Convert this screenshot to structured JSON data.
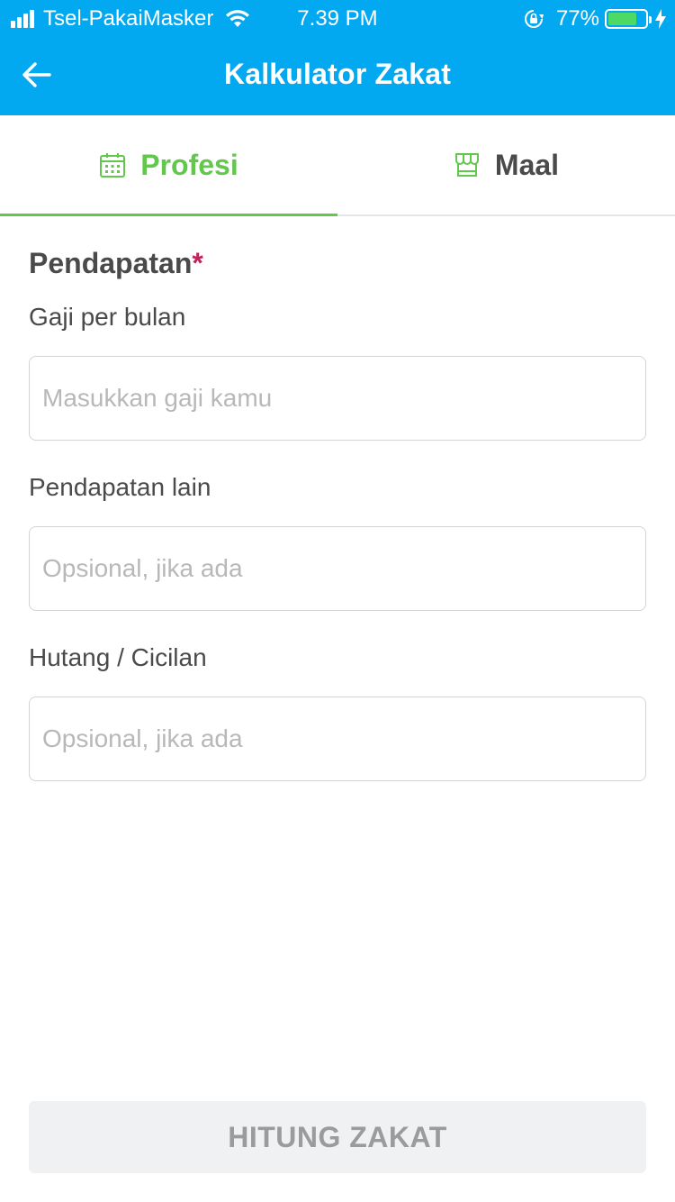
{
  "status_bar": {
    "carrier": "Tsel-PakaiMasker",
    "time": "7.39 PM",
    "battery_percent": "77%",
    "battery_level": 0.77,
    "icons": [
      "signal-icon",
      "wifi-icon",
      "rotation-lock-icon",
      "battery-icon",
      "charging-bolt-icon"
    ]
  },
  "header": {
    "title": "Kalkulator Zakat",
    "back_icon": "arrow-left-icon",
    "background": "#03a9f0"
  },
  "tabs": [
    {
      "label": "Profesi",
      "icon": "calendar-icon",
      "active": true
    },
    {
      "label": "Maal",
      "icon": "store-icon",
      "active": false
    }
  ],
  "form": {
    "section_title": "Pendapatan",
    "required_mark": "*",
    "fields": [
      {
        "label": "Gaji per bulan",
        "value": "",
        "placeholder": "Masukkan gaji kamu"
      },
      {
        "label": "Pendapatan lain",
        "value": "",
        "placeholder": "Opsional, jika ada"
      },
      {
        "label": "Hutang / Cicilan",
        "value": "",
        "placeholder": "Opsional, jika ada"
      }
    ]
  },
  "submit": {
    "label": "HITUNG ZAKAT",
    "enabled": false
  },
  "colors": {
    "primary": "#03a9f0",
    "accent_green": "#61c84b",
    "required_red": "#c0235c",
    "disabled_bg": "#f0f1f3",
    "disabled_text": "#9b9b9b"
  }
}
